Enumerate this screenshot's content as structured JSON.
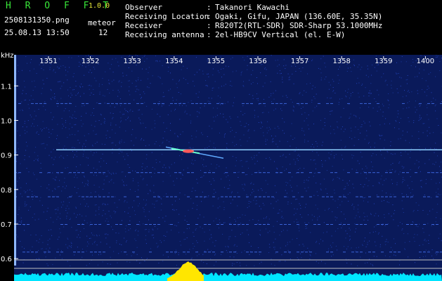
{
  "app": {
    "title": "H R O F F T",
    "version": "1.0.0"
  },
  "file_name": "2508131350.png",
  "timestamp": "25.08.13 13:50",
  "meteor": {
    "label": "meteor",
    "count": "12"
  },
  "meta": [
    {
      "key": "Observer",
      "value": "Takanori Kawachi"
    },
    {
      "key": "Receiving Location",
      "value": "Ogaki, Gifu, JAPAN (136.60E, 35.35N)"
    },
    {
      "key": "Receiver",
      "value": "R820T2(RTL-SDR) SDR-Sharp 53.1000MHz"
    },
    {
      "key": "Receiving antenna",
      "value": "2el-HB9CV Vertical (el. E-W)"
    }
  ],
  "colors": {
    "background": "#000000",
    "title": "#39e639",
    "version": "#e6e639",
    "waterfall": "#0a1a5a",
    "signal": "#8fb8ff",
    "spectrum": "#00e5ff",
    "meteor_hot": "#ffe600"
  },
  "chart_data": {
    "type": "heatmap",
    "ylabel": "kHz",
    "y_ticks": [
      "1.1",
      "1.0",
      "0.9",
      "0.8",
      "0.7",
      "0.6"
    ],
    "x_ticks": [
      "1351",
      "1352",
      "1353",
      "1354",
      "1355",
      "1356",
      "1357",
      "1358",
      "1359",
      "1400"
    ],
    "carrier_khz": 0.915,
    "ylim": [
      0.58,
      1.19
    ]
  }
}
